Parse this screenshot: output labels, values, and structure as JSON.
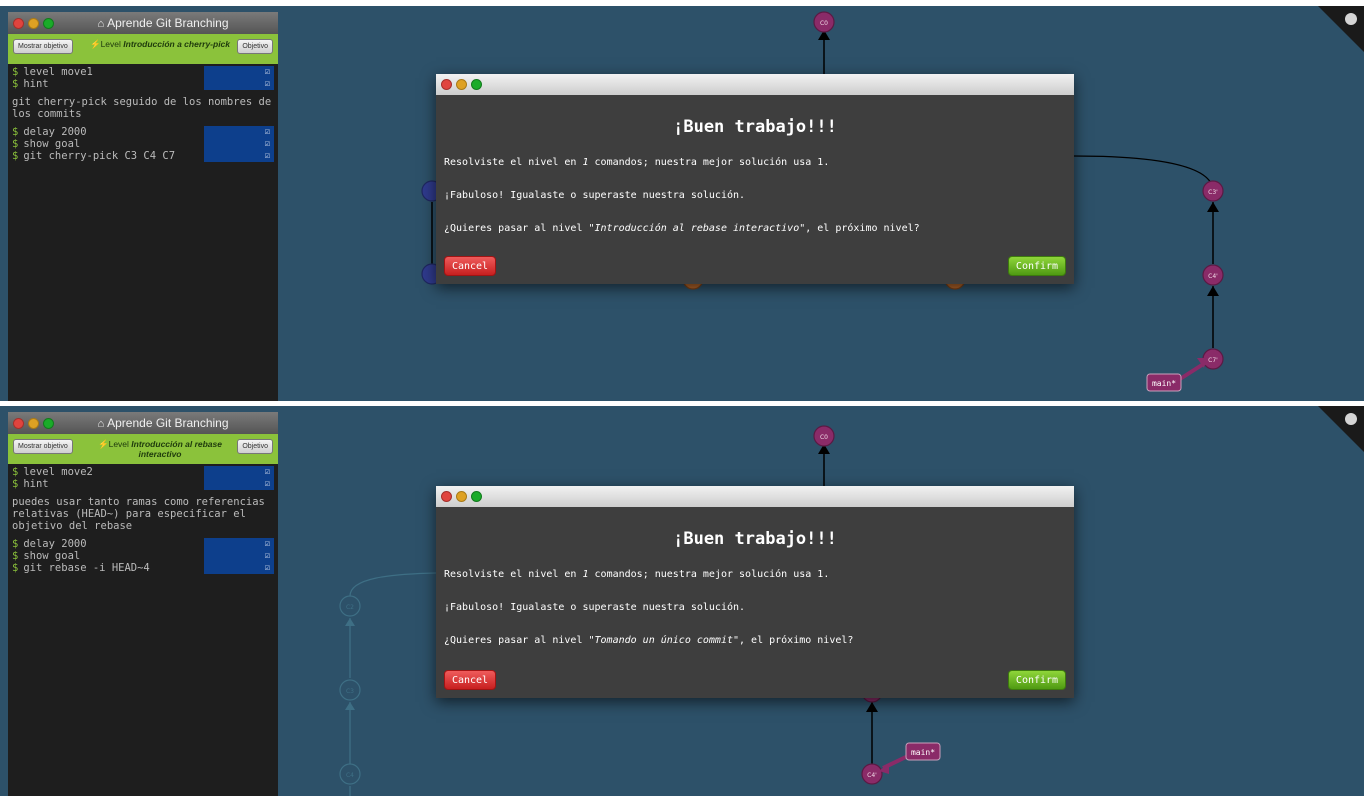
{
  "panels": [
    {
      "window_title": "Aprende Git Branching",
      "show_goal_btn": "Mostrar objetivo",
      "level_prefix": "Level",
      "level_name": "Introducción a cherry-pick",
      "goal_btn": "Objetivo",
      "cmds_a": [
        "level move1",
        "hint"
      ],
      "message": "git cherry-pick seguido de los nombres de los commits",
      "cmds_b": [
        "delay 2000",
        "show goal",
        "git cherry-pick C3 C4 C7"
      ],
      "modal": {
        "title": "¡Buen trabajo!!!",
        "line1_pre": "Resolviste el nivel en ",
        "line1_count": "1",
        "line1_post": " comandos; nuestra mejor solución usa 1.",
        "line2": "¡Fabuloso! Igualaste o superaste nuestra solución.",
        "line3_pre": "¿Quieres pasar al nivel ",
        "next_level": "\"Introducción al rebase interactivo\"",
        "line3_post": ", el próximo nivel?",
        "cancel": "Cancel",
        "confirm": "Confirm"
      },
      "nodes": [
        "C0",
        "C3'",
        "C4'",
        "C7'"
      ],
      "branch": "main*"
    },
    {
      "window_title": "Aprende Git Branching",
      "show_goal_btn": "Mostrar objetivo",
      "level_prefix": "Level",
      "level_name": "Introducción al rebase interactivo",
      "goal_btn": "Objetivo",
      "cmds_a": [
        "level move2",
        "hint"
      ],
      "message": "puedes usar tanto ramas como referencias relativas (HEAD~) para especificar el objetivo del rebase",
      "cmds_b": [
        "delay 2000",
        "show goal",
        "git rebase -i HEAD~4"
      ],
      "modal": {
        "title": "¡Buen trabajo!!!",
        "line1_pre": "Resolviste el nivel en ",
        "line1_count": "1",
        "line1_post": " comandos; nuestra mejor solución usa 1.",
        "line2": "¡Fabuloso! Igualaste o superaste nuestra solución.",
        "line3_pre": "¿Quieres pasar al nivel ",
        "next_level": "\"Tomando un único commit\"",
        "line3_post": ", el próximo nivel?",
        "cancel": "Cancel",
        "confirm": "Confirm"
      },
      "nodes": [
        "C0",
        "C2",
        "C3",
        "C4",
        "C4'"
      ],
      "branch": "main*"
    }
  ],
  "colors": {
    "background": "#2d5169",
    "commit_purple": "#8a2b68",
    "commit_faded": "#3e6f85",
    "commit_blue": "#2f3a8c",
    "commit_orange": "#b5652a",
    "level_bar": "#8bc23b"
  }
}
